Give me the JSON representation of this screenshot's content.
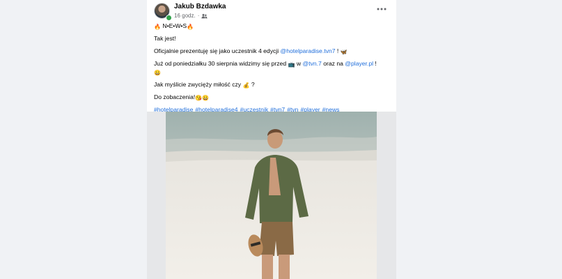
{
  "post": {
    "author": "Jakub Bzdawka",
    "time": "16 godz.",
    "separator": "·",
    "title_line": "N•E•W•S",
    "line1": "Tak jest!",
    "line2_prefix": "Oficjalnie prezentuję się jako uczestnik 4 edycji ",
    "line2_mention": "@hotelparadise.tvn7",
    "line2_suffix": " !",
    "line3_prefix": "Już od poniedziałku 30 sierpnia widzimy się przed ",
    "line3_w": " w ",
    "line3_mention1": "@tvn.7",
    "line3_middle": " oraz na ",
    "line3_mention2": "@player.pl",
    "line3_suffix": " !",
    "line4_prefix": "Jak myślicie zwycięży miłość czy ",
    "line4_suffix": " ?",
    "line5": "Do zobaczenia!",
    "hashtags": [
      "#hotelparadise",
      "#hotelparadise4",
      "#uczestnik",
      "#tvn7",
      "#tvn",
      "#player",
      "#news"
    ]
  },
  "icons": {
    "avatar": "profile-photo",
    "more": "more-options-icon",
    "audience": "friends-icon",
    "fire": "fire-emoji",
    "butterfly": "butterfly-emoji",
    "tv": "television-emoji",
    "smile": "smile-emoji",
    "money": "money-bag-emoji",
    "kiss": "kissing-emoji"
  },
  "colors": {
    "link": "#216fdb",
    "background": "#f0f2f5",
    "card": "#ffffff",
    "online": "#31a24c"
  }
}
